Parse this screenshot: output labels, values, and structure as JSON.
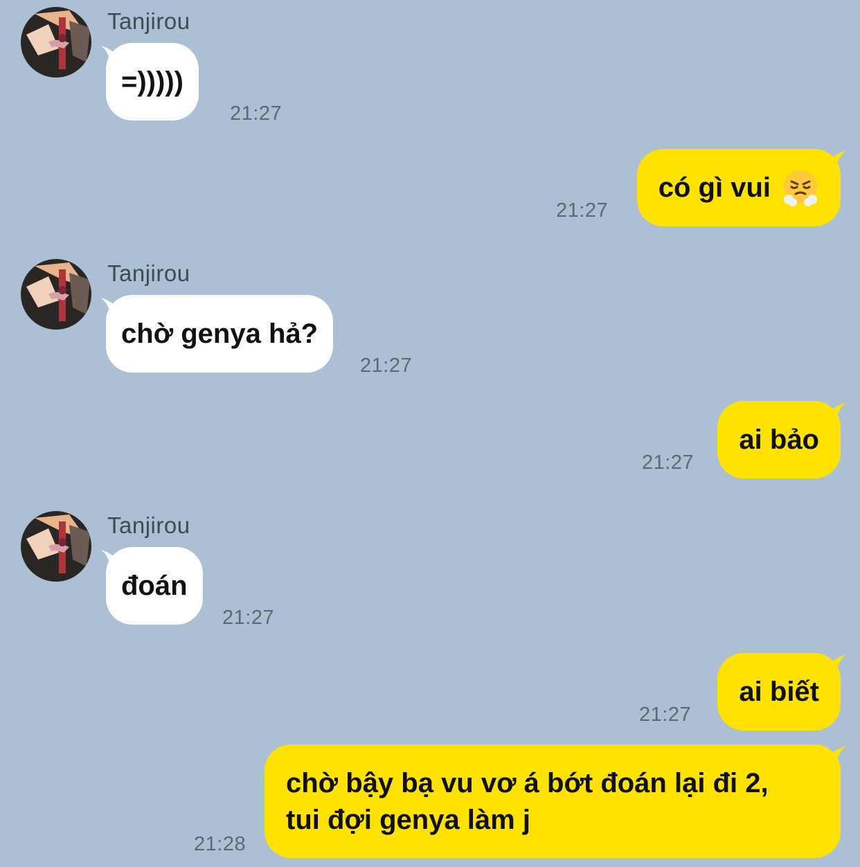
{
  "colors": {
    "background": "#abc1d3",
    "incoming_bubble": "#ffffff",
    "outgoing_bubble": "#ffe200",
    "timestamp": "#5d6874"
  },
  "messages": [
    {
      "direction": "incoming",
      "sender": "Tanjirou",
      "text": "=)))))",
      "time": "21:27",
      "avatar": "tanjirou-avatar"
    },
    {
      "direction": "outgoing",
      "text": "có gì vui",
      "emoji": "face-with-steam-from-nose-icon",
      "time": "21:27"
    },
    {
      "direction": "incoming",
      "sender": "Tanjirou",
      "text": "chờ genya hả?",
      "time": "21:27",
      "avatar": "tanjirou-avatar"
    },
    {
      "direction": "outgoing",
      "text": "ai bảo",
      "time": "21:27"
    },
    {
      "direction": "incoming",
      "sender": "Tanjirou",
      "text": "đoán",
      "time": "21:27",
      "avatar": "tanjirou-avatar"
    },
    {
      "direction": "outgoing",
      "text": "ai biết",
      "time": "21:27"
    },
    {
      "direction": "outgoing",
      "lines": [
        "chờ bậy bạ vu vơ á bớt đoán lại đi 2,",
        "tui đợi genya làm j"
      ],
      "time": "21:28"
    }
  ]
}
